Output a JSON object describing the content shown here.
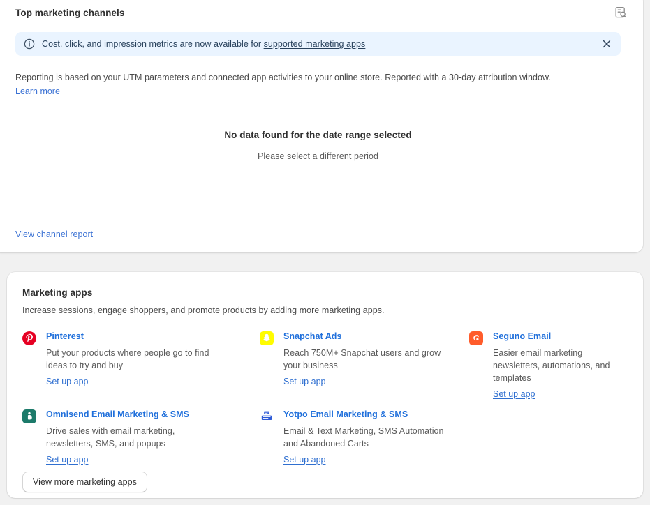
{
  "channels_card": {
    "title": "Top marketing channels",
    "report_icon": "report-search-icon",
    "banner": {
      "icon": "info-circle-icon",
      "text": "Cost, click, and impression metrics are now available for ",
      "link_label": "supported marketing apps",
      "close_icon": "close-icon",
      "background_color": "#eaf4ff",
      "text_color": "#28415c"
    },
    "description": "Reporting is based on your UTM parameters and connected app activities to your online store. Reported with a 30-day attribution window.",
    "learn_more_label": "Learn more",
    "empty_state": {
      "title": "No data found for the date range selected",
      "subtitle": "Please select a different period"
    },
    "footer_link_label": "View channel report"
  },
  "apps_card": {
    "title": "Marketing apps",
    "subtitle": "Increase sessions, engage shoppers, and promote products by adding more marketing apps.",
    "cta_label": "Set up app",
    "apps": [
      {
        "name": "Pinterest",
        "description": "Put your products where people go to find ideas to try and buy",
        "cta": "Set up app",
        "icon": "pinterest-icon",
        "icon_color": "#e60023"
      },
      {
        "name": "Snapchat Ads",
        "description": "Reach 750M+ Snapchat users and grow your business",
        "cta": "Set up app",
        "icon": "snapchat-icon",
        "icon_color": "#fffc00"
      },
      {
        "name": "Seguno Email",
        "description": "Easier email marketing newsletters, automations, and templates",
        "cta": "Set up app",
        "icon": "seguno-icon",
        "icon_color": "#ff5c2b"
      },
      {
        "name": "Omnisend Email Marketing & SMS",
        "description": "Drive sales with email marketing, newsletters, SMS, and popups",
        "cta": "Set up app",
        "icon": "omnisend-icon",
        "icon_color": "#1c7a6a"
      },
      {
        "name": "Yotpo Email Marketing & SMS",
        "description": "Email & Text Marketing, SMS Automation and Abandoned Carts",
        "cta": "Set up app",
        "icon": "yotpo-icon",
        "icon_color": "#2e5bd6"
      }
    ],
    "view_more_label": "View more marketing apps"
  },
  "theme": {
    "page_background": "#f1f1f1",
    "card_background": "#ffffff",
    "link_color": "#1f6fdb",
    "heading_color": "#303030",
    "body_text_color": "#5a5a5a"
  }
}
